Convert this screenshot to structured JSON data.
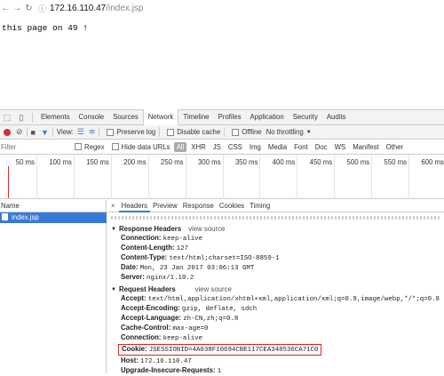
{
  "browser": {
    "url_host": "172.16.110.47",
    "url_path": "/index.jsp"
  },
  "page": {
    "text": "this page on 49 !"
  },
  "devtools": {
    "tabs": [
      "Elements",
      "Console",
      "Sources",
      "Network",
      "Timeline",
      "Profiles",
      "Application",
      "Security",
      "Audits"
    ],
    "active_tab": "Network",
    "toolbar": {
      "view_label": "View:",
      "preserve_log": "Preserve log",
      "disable_cache": "Disable cache",
      "offline": "Offline",
      "throttling": "No throttling"
    },
    "filter": {
      "placeholder": "Filter",
      "regex": "Regex",
      "hide_data_urls": "Hide data URLs",
      "types": [
        "All",
        "XHR",
        "JS",
        "CSS",
        "Img",
        "Media",
        "Font",
        "Doc",
        "WS",
        "Manifest",
        "Other"
      ]
    },
    "timeline_ticks": [
      "50 ms",
      "100 ms",
      "150 ms",
      "200 ms",
      "250 ms",
      "300 ms",
      "350 ms",
      "400 ms",
      "450 ms",
      "500 ms",
      "550 ms",
      "600 ms"
    ],
    "name_header": "Name",
    "requests": [
      {
        "name": "index.jsp"
      }
    ],
    "detail_tabs": [
      "Headers",
      "Preview",
      "Response",
      "Cookies",
      "Timing"
    ],
    "active_detail_tab": "Headers",
    "response_headers": {
      "title": "Response Headers",
      "view_source": "view source",
      "items": [
        {
          "name": "Connection:",
          "value": "keep-alive"
        },
        {
          "name": "Content-Length:",
          "value": "127"
        },
        {
          "name": "Content-Type:",
          "value": "text/html;charset=ISO-8859-1"
        },
        {
          "name": "Date:",
          "value": "Mon, 23 Jan 2017 03:06:13 GMT"
        },
        {
          "name": "Server:",
          "value": "nginx/1.10.2"
        }
      ]
    },
    "request_headers": {
      "title": "Request Headers",
      "view_source": "view source",
      "items": [
        {
          "name": "Accept:",
          "value": "text/html,application/xhtml+xml,application/xml;q=0.9,image/webp,*/*;q=0.8"
        },
        {
          "name": "Accept-Encoding:",
          "value": "gzip, deflate, sdch"
        },
        {
          "name": "Accept-Language:",
          "value": "zh-CN,zh;q=0.8"
        },
        {
          "name": "Cache-Control:",
          "value": "max-age=0"
        },
        {
          "name": "Connection:",
          "value": "keep-alive"
        },
        {
          "name": "Cookie:",
          "value": "JSESSIONID=4A038F10694CBE117CEA348536CA71C0"
        },
        {
          "name": "Host:",
          "value": "172.16.110.47"
        },
        {
          "name": "Upgrade-Insecure-Requests:",
          "value": "1"
        }
      ]
    },
    "colors": {
      "accent": "#3879d9",
      "record": "#d32f2f",
      "highlight_box": "#dd2222"
    }
  }
}
